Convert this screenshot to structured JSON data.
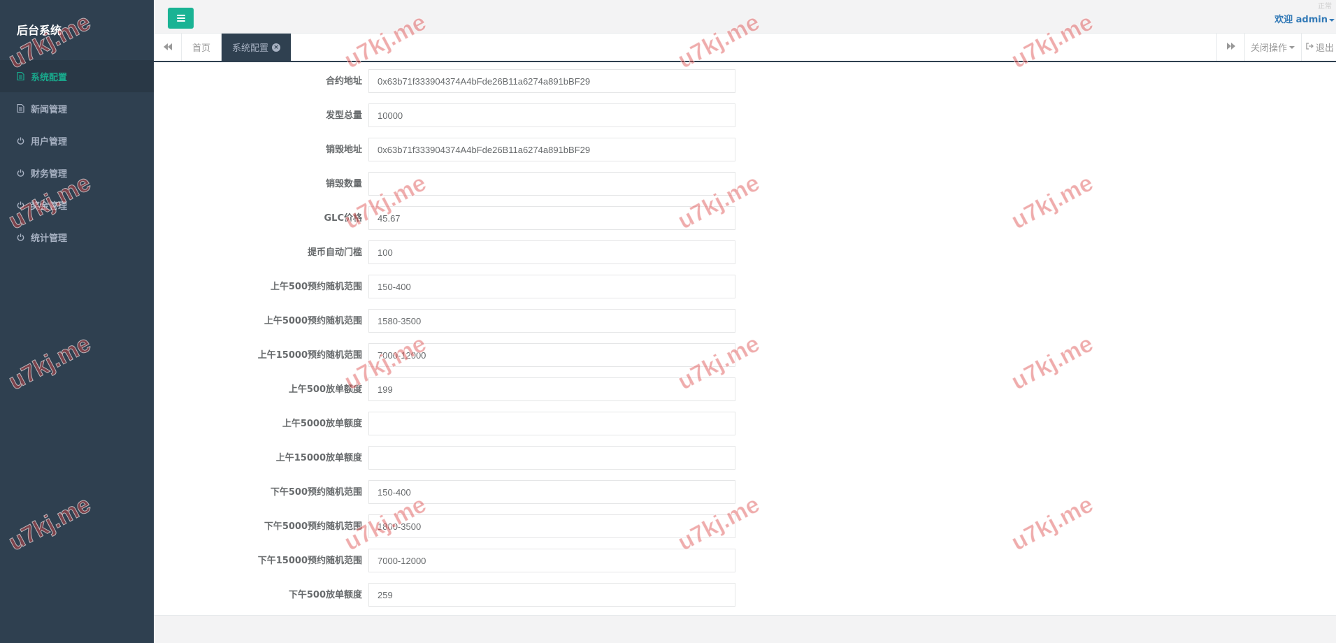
{
  "sidebar": {
    "brand": "后台系统",
    "items": [
      {
        "label": "系统配置",
        "icon": "document-icon",
        "active": true
      },
      {
        "label": "新闻管理",
        "icon": "document-icon",
        "active": false
      },
      {
        "label": "用户管理",
        "icon": "power-icon",
        "active": false
      },
      {
        "label": "财务管理",
        "icon": "power-icon",
        "active": false
      },
      {
        "label": "奖金管理",
        "icon": "power-icon",
        "active": false
      },
      {
        "label": "统计管理",
        "icon": "power-icon",
        "active": false
      }
    ]
  },
  "header": {
    "welcome": "欢迎 admin",
    "corner_text": "正常"
  },
  "tabs": {
    "home": "首页",
    "active": "系统配置",
    "close_ops": "关闭操作",
    "logout": "退出"
  },
  "form": {
    "fields": [
      {
        "label": "合约地址",
        "value": "0x63b71f333904374A4bFde26B11a6274a891bBF29"
      },
      {
        "label": "发型总量",
        "value": "10000"
      },
      {
        "label": "销毁地址",
        "value": "0x63b71f333904374A4bFde26B11a6274a891bBF29"
      },
      {
        "label": "销毁数量",
        "value": ""
      },
      {
        "label": "GLC价格",
        "value": "45.67"
      },
      {
        "label": "提币自动门槛",
        "value": "100"
      },
      {
        "label": "上午500预约随机范围",
        "value": "150-400"
      },
      {
        "label": "上午5000预约随机范围",
        "value": "1580-3500"
      },
      {
        "label": "上午15000预约随机范围",
        "value": "7000-12000"
      },
      {
        "label": "上午500放单额度",
        "value": "199"
      },
      {
        "label": "上午5000放单额度",
        "value": ""
      },
      {
        "label": "上午15000放单额度",
        "value": ""
      },
      {
        "label": "下午500预约随机范围",
        "value": "150-400"
      },
      {
        "label": "下午5000预约随机范围",
        "value": "1800-3500"
      },
      {
        "label": "下午15000预约随机范围",
        "value": "7000-12000"
      },
      {
        "label": "下午500放单额度",
        "value": "259"
      }
    ]
  },
  "watermark": "u7kj.me",
  "colors": {
    "sidebar_bg": "#2f4050",
    "accent": "#1ab394",
    "active_text": "#19aa8d",
    "link": "#337ab7"
  }
}
